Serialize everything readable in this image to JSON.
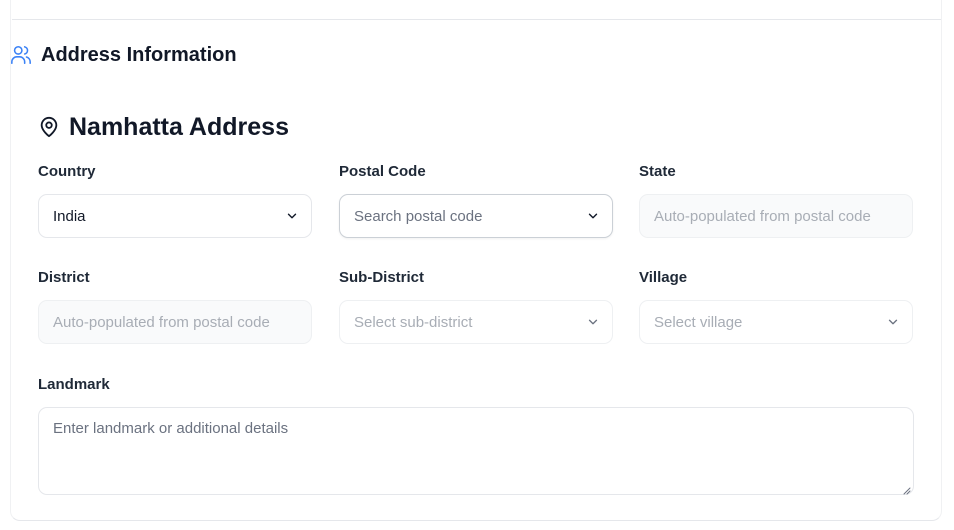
{
  "section": {
    "title": "Address Information",
    "icon": "users-icon"
  },
  "address": {
    "title": "Namhatta Address",
    "icon": "map-pin-icon"
  },
  "fields": {
    "country": {
      "label": "Country",
      "value": "India"
    },
    "postal_code": {
      "label": "Postal Code",
      "placeholder": "Search postal code"
    },
    "state": {
      "label": "State",
      "placeholder": "Auto-populated from postal code"
    },
    "district": {
      "label": "District",
      "placeholder": "Auto-populated from postal code"
    },
    "sub_district": {
      "label": "Sub-District",
      "placeholder": "Select sub-district"
    },
    "village": {
      "label": "Village",
      "placeholder": "Select village"
    },
    "landmark": {
      "label": "Landmark",
      "placeholder": "Enter landmark or additional details"
    }
  },
  "colors": {
    "accent": "#3b82f6",
    "text": "#111827",
    "border": "#e5e7eb",
    "disabled_bg": "#f9fafb"
  }
}
